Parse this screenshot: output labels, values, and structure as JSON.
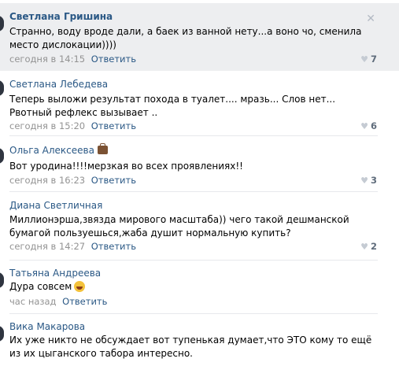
{
  "comments": [
    {
      "author": "Светлана Гришина",
      "text": "Странно, воду вроде дали, а баек из ванной нету...а воно чо, сменила место дислокации))))",
      "time": "сегодня в 14:15",
      "reply": "Ответить",
      "likes": "7"
    },
    {
      "author": "Светлана Лебедева",
      "text": "Теперь выложи результат похода в туалет.... мразь... Слов нет... Рвотный рефлекс вызывает ..",
      "time": "сегодня в 15:20",
      "reply": "Ответить",
      "likes": "6"
    },
    {
      "author": "Ольга Алексеева",
      "text": "Вот уродина!!!!мерзкая во всех проявлениях!!",
      "time": "сегодня в 16:23",
      "reply": "Ответить",
      "likes": "3"
    },
    {
      "author": "Диана Светличная",
      "text": "Миллионэрша,звязда мирового масштаба)) чего такой дешманской бумагой пользуешься,жаба душит нормальную купить?",
      "time": "сегодня в 14:27",
      "reply": "Ответить",
      "likes": "2"
    },
    {
      "author": "Татьяна Андреева",
      "text": "Дура совсем",
      "time": "час назад",
      "reply": "Ответить",
      "likes": ""
    },
    {
      "author": "Вика Макарова",
      "text": "Их уже никто не обсуждает вот тупенькая думает,что ЭТО кому то ещё из их цыганского табора интересно.",
      "time": "",
      "reply": "",
      "likes": ""
    }
  ],
  "icons": {
    "like": "heart-icon",
    "close": "close-icon",
    "author_badge": "briefcase-emoji",
    "emoji": "scream-emoji"
  }
}
